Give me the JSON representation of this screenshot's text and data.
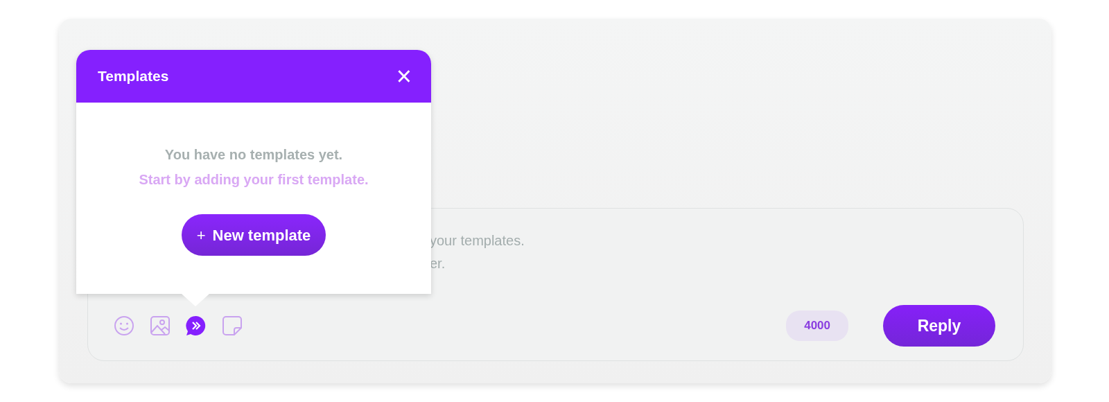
{
  "composer": {
    "text_lines": [
      "your templates.",
      "er."
    ],
    "toolbar": [
      {
        "kind": "emoji",
        "selected": false
      },
      {
        "kind": "image",
        "selected": false
      },
      {
        "kind": "templates",
        "selected": true
      },
      {
        "kind": "sticker",
        "selected": false
      }
    ],
    "counter": "4000",
    "reply_button": "Reply"
  },
  "templates_popover": {
    "title": "Templates",
    "close": "×",
    "empty_message": "You have no templates yet.",
    "hint": "Start by adding your first template.",
    "new_button_icon": "+",
    "new_button": "New template"
  }
}
